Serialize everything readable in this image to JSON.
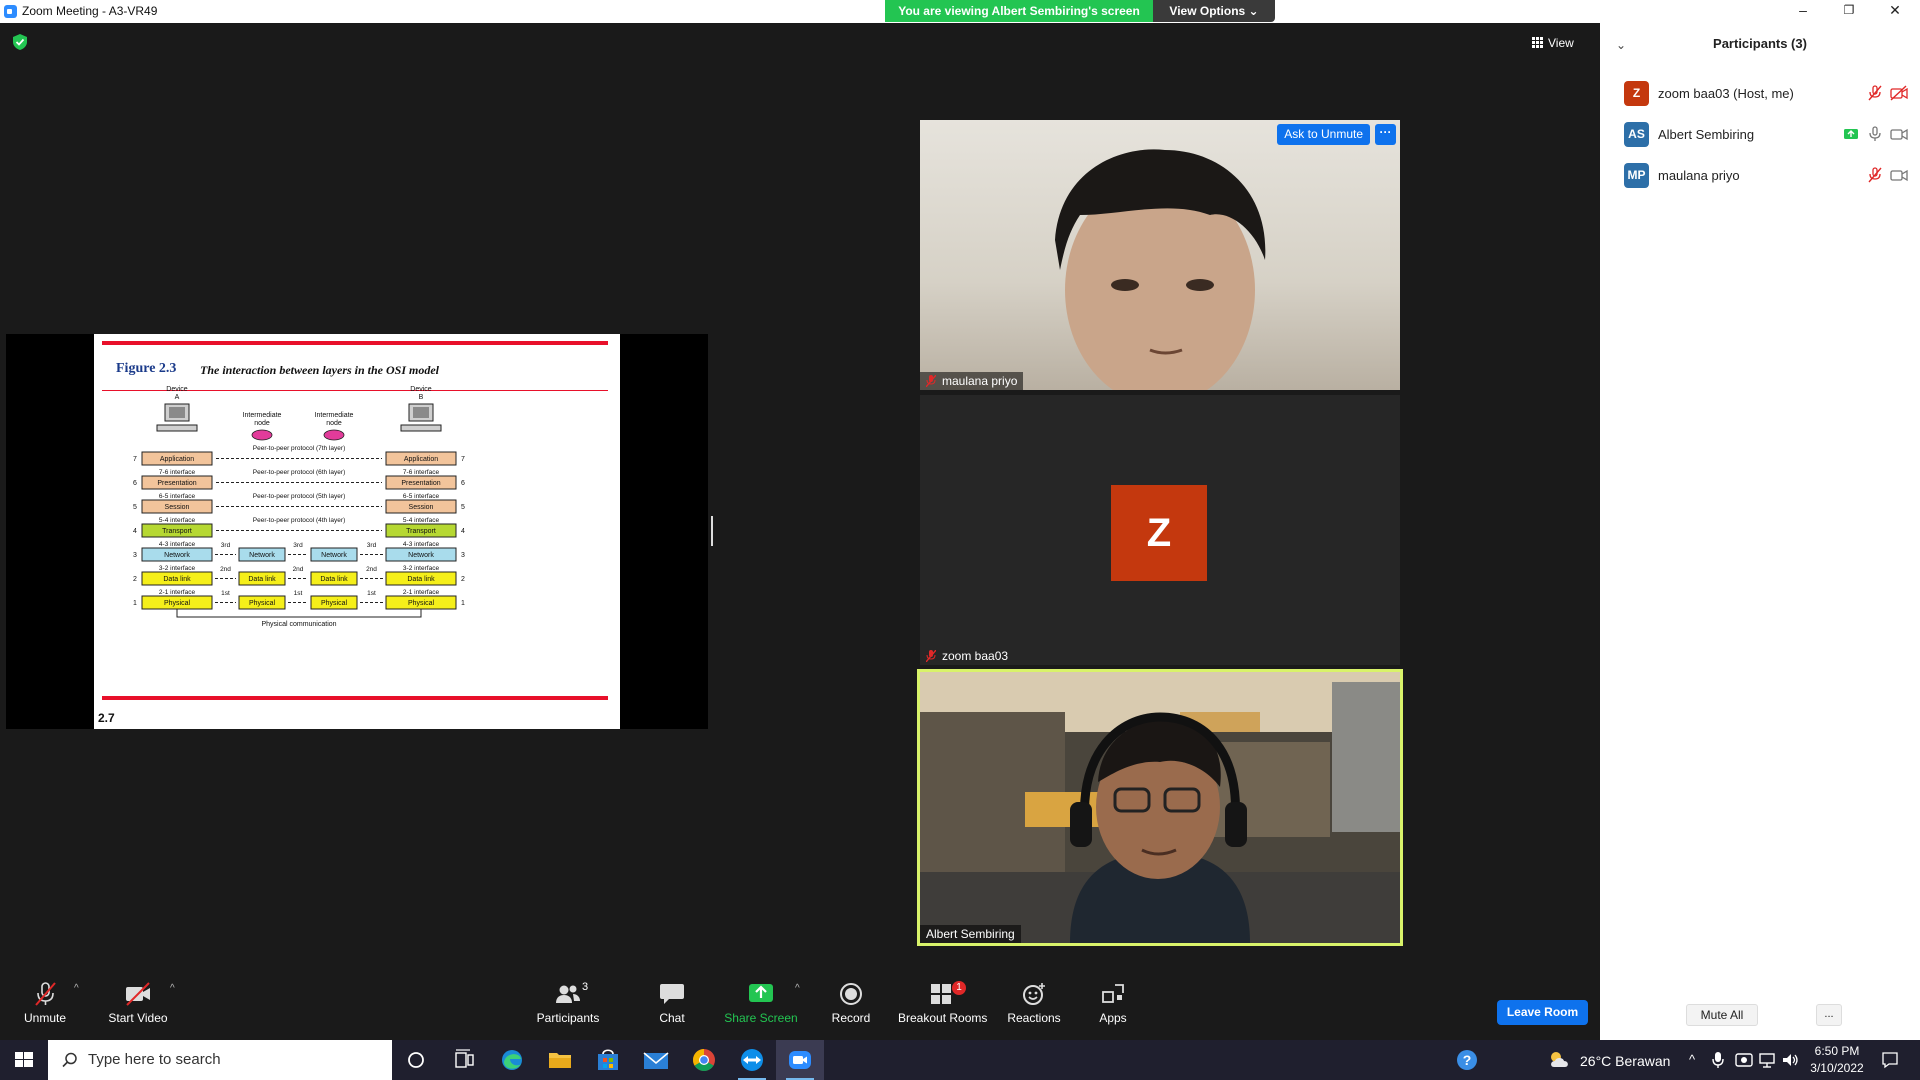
{
  "window": {
    "title": "Zoom Meeting - A3-VR49",
    "minimize": "–",
    "restore": "❐",
    "close": "✕"
  },
  "banner": {
    "viewing_text": "You are viewing Albert Sembiring's screen",
    "view_options": "View Options ⌄"
  },
  "meeting": {
    "view_label": "View"
  },
  "slide": {
    "figure_label": "Figure 2.3",
    "caption": "The interaction between layers in the OSI model",
    "slide_number": "2.7",
    "device_a": [
      "Device",
      "A"
    ],
    "device_b": [
      "Device",
      "B"
    ],
    "intermediate": [
      "Intermediate",
      "node"
    ],
    "peer_protocols": [
      "Peer-to-peer protocol (7th layer)",
      "Peer-to-peer protocol (6th layer)",
      "Peer-to-peer protocol (5th layer)",
      "Peer-to-peer protocol (4th layer)"
    ],
    "layers": [
      {
        "num": "7",
        "name": "Application",
        "color": "#f2c49b"
      },
      {
        "num": "6",
        "name": "Presentation",
        "color": "#f2c49b"
      },
      {
        "num": "5",
        "name": "Session",
        "color": "#f2c49b"
      },
      {
        "num": "4",
        "name": "Transport",
        "color": "#b6d832"
      },
      {
        "num": "3",
        "name": "Network",
        "color": "#a9dcec"
      },
      {
        "num": "2",
        "name": "Data link",
        "color": "#f5ef1a"
      },
      {
        "num": "1",
        "name": "Physical",
        "color": "#f5ef1a"
      }
    ],
    "interfaces": [
      "7-6 interface",
      "6-5 interface",
      "5-4 interface",
      "4-3 interface",
      "3-2 interface",
      "2-1 interface"
    ],
    "hop_labels": [
      "3rd",
      "2nd",
      "1st"
    ],
    "physical_comm": "Physical communication"
  },
  "tiles": {
    "tile1_name": "maulana priyo",
    "tile1_ask_unmute": "Ask to Unmute",
    "tile1_more": "···",
    "tile2_name": "zoom baa03",
    "tile2_avatar": "Z",
    "tile3_name": "Albert Sembiring"
  },
  "participants_panel": {
    "title": "Participants (3)",
    "collapse": "⌄",
    "items": [
      {
        "initials": "Z",
        "name": "zoom baa03 (Host, me)",
        "color": "#c4380e"
      },
      {
        "initials": "AS",
        "name": "Albert Sembiring",
        "color": "#2d6fa8"
      },
      {
        "initials": "MP",
        "name": "maulana priyo",
        "color": "#2d6fa8"
      }
    ],
    "mute_all": "Mute All",
    "more": "..."
  },
  "toolbar": {
    "unmute": "Unmute",
    "start_video": "Start Video",
    "participants": "Participants",
    "participants_count": "3",
    "chat": "Chat",
    "share_screen": "Share Screen",
    "record": "Record",
    "breakout_rooms": "Breakout Rooms",
    "breakout_badge": "1",
    "reactions": "Reactions",
    "apps": "Apps",
    "leave": "Leave Room",
    "caret": "^"
  },
  "taskbar": {
    "search_placeholder": "Type here to search",
    "weather": "26°C  Berawan",
    "time": "6:50 PM",
    "date": "3/10/2022"
  },
  "colors": {
    "accent_blue": "#0e72ed",
    "share_green": "#23c552",
    "speaker_border": "#d9f36a",
    "slide_red": "#e8102a"
  }
}
